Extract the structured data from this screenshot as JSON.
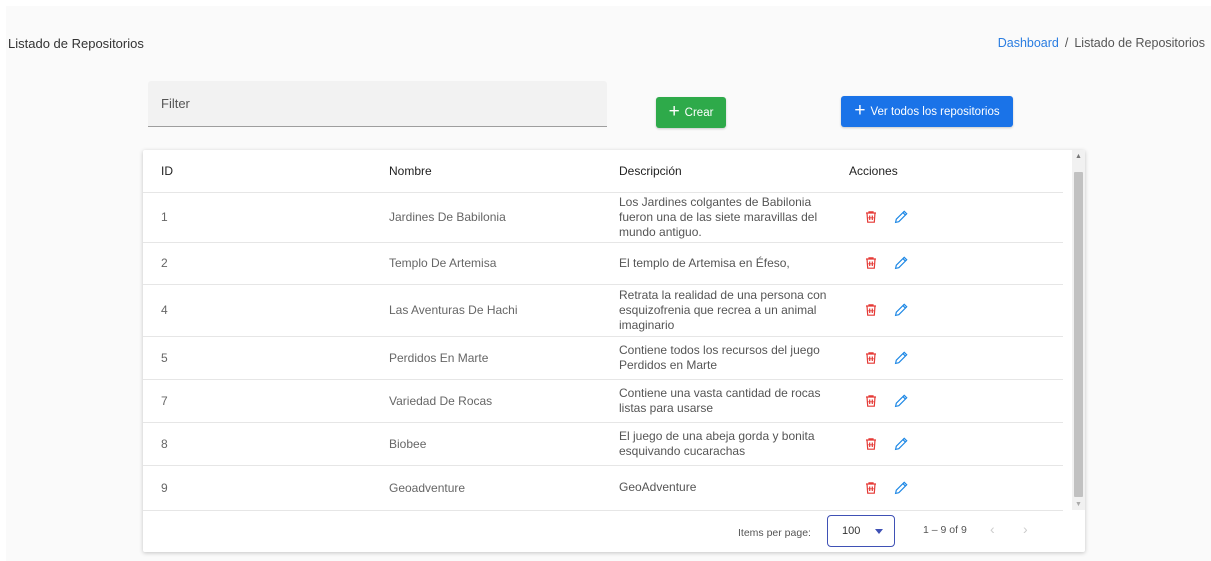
{
  "header": {
    "title": "Listado de Repositorios",
    "breadcrumb": {
      "home": "Dashboard",
      "separator": "/",
      "current": "Listado de Repositorios"
    }
  },
  "filter": {
    "placeholder": "Filter",
    "value": ""
  },
  "buttons": {
    "create": {
      "icon": "plus-icon",
      "label": "Crear"
    },
    "view_all": {
      "icon": "plus-icon",
      "label": "Ver todos los repositorios"
    }
  },
  "table": {
    "columns": [
      "ID",
      "Nombre",
      "Descripción",
      "Acciones"
    ],
    "rows": [
      {
        "id": "1",
        "nombre": "Jardines De Babilonia",
        "descripcion": "Los Jardines colgantes de Babilonia fueron una de las siete maravillas del mundo antiguo."
      },
      {
        "id": "2",
        "nombre": "Templo De Artemisa",
        "descripcion": "El templo de Artemisa en Éfeso,"
      },
      {
        "id": "4",
        "nombre": "Las Aventuras De Hachi",
        "descripcion": "Retrata la realidad de una persona con esquizofrenia que recrea a un animal imaginario"
      },
      {
        "id": "5",
        "nombre": "Perdidos En Marte",
        "descripcion": "Contiene todos los recursos del juego Perdidos en Marte"
      },
      {
        "id": "7",
        "nombre": "Variedad De Rocas",
        "descripcion": "Contiene una vasta cantidad de rocas listas para usarse"
      },
      {
        "id": "8",
        "nombre": "Biobee",
        "descripcion": "El juego de una abeja gorda y bonita esquivando cucarachas"
      },
      {
        "id": "9",
        "nombre": "Geoadventure",
        "descripcion": "GeoAdventure"
      }
    ],
    "actions": {
      "delete_icon": "trash-icon",
      "edit_icon": "pencil-icon"
    }
  },
  "paginator": {
    "items_per_page_label": "Items per page:",
    "items_per_page": "100",
    "range_label": "1 – 9 of 9",
    "prev_icon": "chevron-left-icon",
    "next_icon": "chevron-right-icon"
  },
  "colors": {
    "create_button": "#2eaa4a",
    "view_all_button": "#1a73e8",
    "delete_icon": "#e53935",
    "edit_icon": "#1e88e5",
    "link": "#2a7de1",
    "select_border": "#3f51b5"
  }
}
